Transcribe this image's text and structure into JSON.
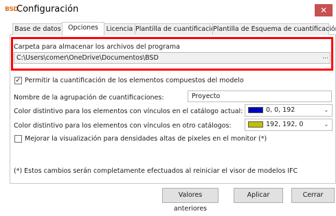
{
  "window": {
    "app_icon": "BSD",
    "title": "Configuración",
    "close_glyph": "✕"
  },
  "tabs": [
    {
      "label": "Base de datos",
      "active": false
    },
    {
      "label": "Opciones",
      "active": true
    },
    {
      "label": "Licencia",
      "active": false
    },
    {
      "label": "Plantilla de cuantificación",
      "active": false
    },
    {
      "label": "Plantilla de Esquema de cuantificación",
      "active": false
    }
  ],
  "folder": {
    "label": "Carpeta para almacenar los archivos del programa",
    "value": "C:\\Users\\comer\\OneDrive\\Documentos\\BSD",
    "browse": "..."
  },
  "options": {
    "composite": {
      "label": "Permitir la cuantificación de los elementos compuestos del modelo",
      "checked": true,
      "mark": "✓"
    },
    "group_name": {
      "label": "Nombre de la agrupación de cuantificaciones:",
      "value": "Proyecto"
    },
    "color_current": {
      "label": "Color distintivo para los elementos con vínculos en el catálogo actual:",
      "value": "0, 0, 192",
      "color": "#0000c0"
    },
    "color_other": {
      "label": "Color distintivo para los elementos con vínculos en otro catálogos:",
      "value": "192, 192, 0",
      "color": "#c0c000"
    },
    "high_dpi": {
      "label": "Mejorar la visualización para densidades altas de pixeles en el monitor (*)",
      "checked": false
    }
  },
  "note": "(*) Estos cambios serán completamente efectuados al reiniciar el visor de modelos IFC",
  "buttons": {
    "previous": "Valores anteriores",
    "apply": "Aplicar",
    "close": "Cerrar"
  },
  "icons": {
    "chevron": "chevron-down-icon",
    "close": "close-icon"
  }
}
